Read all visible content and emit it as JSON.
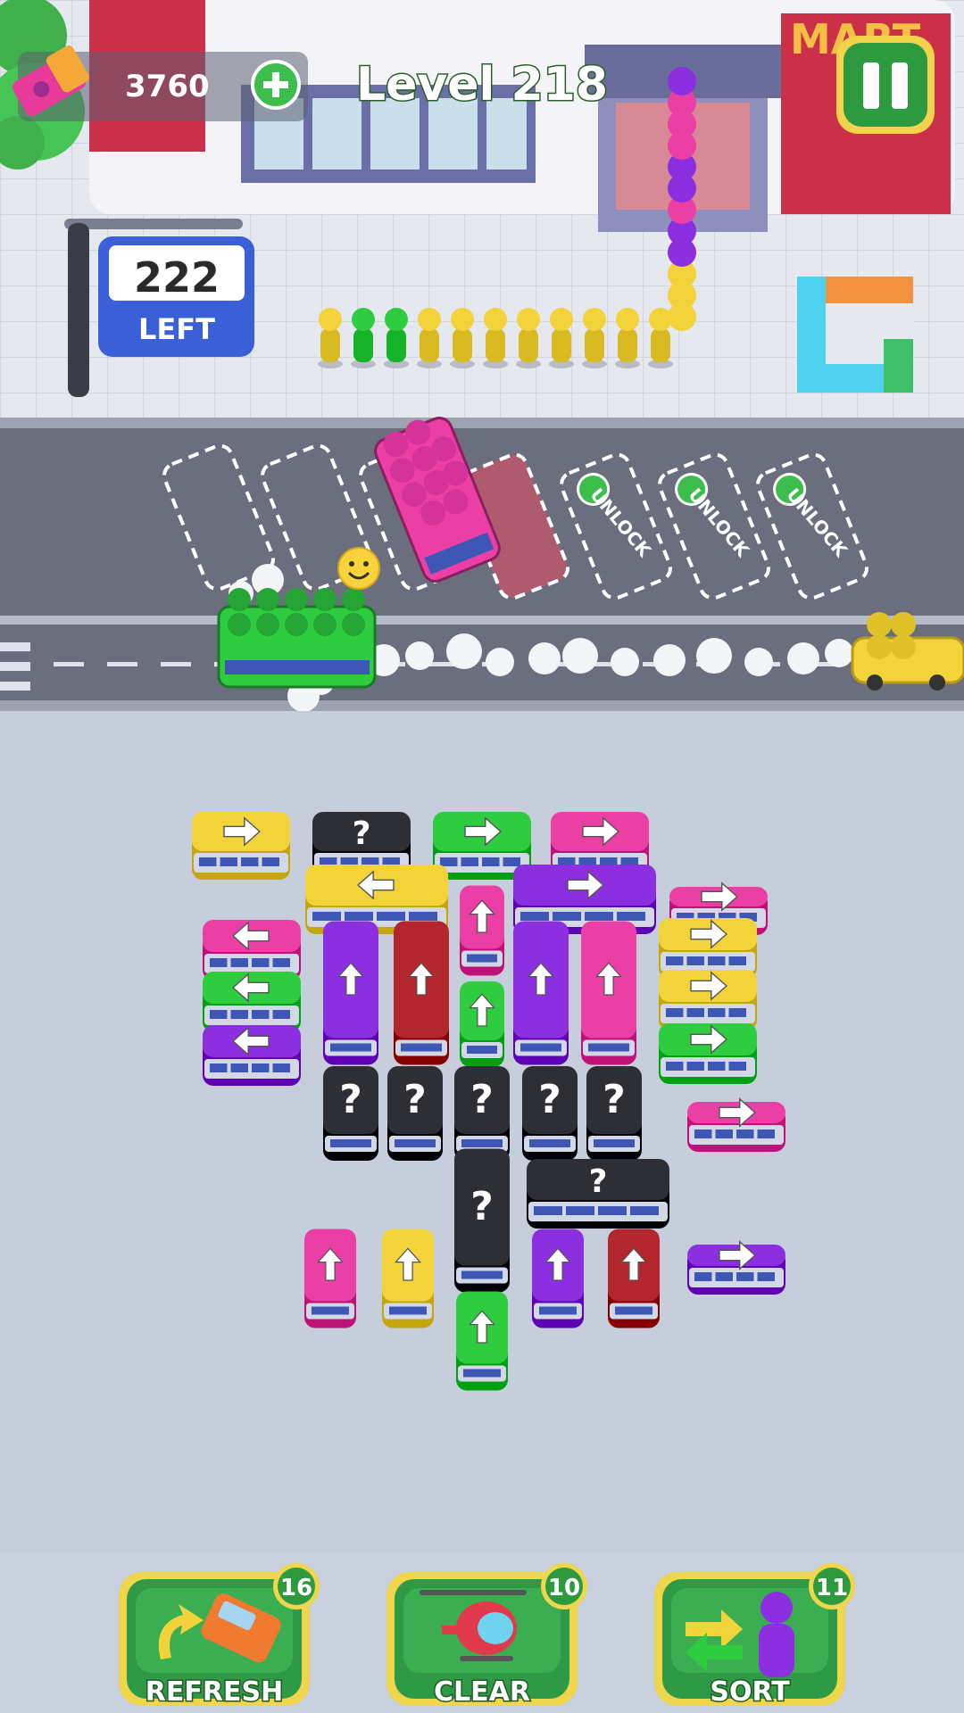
{
  "hud": {
    "currency_amount": "3760",
    "level_label": "Level 218",
    "left_count": "222",
    "left_label": "LEFT"
  },
  "store": {
    "sign_text": "MART"
  },
  "slots": {
    "unlock_label": "UNLOCK"
  },
  "boosters": [
    {
      "label": "REFRESH",
      "count": "16",
      "icon": "refresh-car-icon"
    },
    {
      "label": "CLEAR",
      "count": "10",
      "icon": "helicopter-icon"
    },
    {
      "label": "SORT",
      "count": "11",
      "icon": "sort-person-icon"
    }
  ],
  "colors": {
    "yellow": "#f2d33a",
    "green": "#2ecc3f",
    "pink": "#ec3fa5",
    "purple": "#8c2fe0",
    "red": "#b3262e",
    "black": "#2e2f35",
    "road": "#686b7a",
    "lot": "#c6cddb",
    "button_green": "#2f9a45"
  },
  "lot_vehicles": [
    {
      "kind": "van",
      "color": "yellow",
      "dir": "right"
    },
    {
      "kind": "van",
      "color": "black",
      "dir": "mystery"
    },
    {
      "kind": "van",
      "color": "green",
      "dir": "right"
    },
    {
      "kind": "van",
      "color": "pink",
      "dir": "right"
    },
    {
      "kind": "bus",
      "color": "yellow",
      "dir": "left"
    },
    {
      "kind": "bus",
      "color": "purple",
      "dir": "right"
    },
    {
      "kind": "car",
      "color": "pink",
      "dir": "up"
    },
    {
      "kind": "car",
      "color": "pink",
      "dir": "right"
    },
    {
      "kind": "van",
      "color": "pink",
      "dir": "left"
    },
    {
      "kind": "van",
      "color": "green",
      "dir": "left"
    },
    {
      "kind": "van",
      "color": "purple",
      "dir": "left"
    },
    {
      "kind": "bus",
      "color": "purple",
      "dir": "up"
    },
    {
      "kind": "bus",
      "color": "red",
      "dir": "up"
    },
    {
      "kind": "car",
      "color": "green",
      "dir": "up"
    },
    {
      "kind": "bus",
      "color": "purple",
      "dir": "up"
    },
    {
      "kind": "bus",
      "color": "pink",
      "dir": "up"
    },
    {
      "kind": "van",
      "color": "yellow",
      "dir": "right"
    },
    {
      "kind": "van",
      "color": "yellow",
      "dir": "right"
    },
    {
      "kind": "van",
      "color": "green",
      "dir": "right"
    },
    {
      "kind": "van",
      "color": "black",
      "dir": "mystery"
    },
    {
      "kind": "van",
      "color": "black",
      "dir": "mystery"
    },
    {
      "kind": "van",
      "color": "black",
      "dir": "mystery"
    },
    {
      "kind": "van",
      "color": "black",
      "dir": "mystery"
    },
    {
      "kind": "van",
      "color": "black",
      "dir": "mystery"
    },
    {
      "kind": "car",
      "color": "pink",
      "dir": "right"
    },
    {
      "kind": "bus",
      "color": "black",
      "dir": "mystery"
    },
    {
      "kind": "bus",
      "color": "black",
      "dir": "mystery"
    },
    {
      "kind": "van",
      "color": "pink",
      "dir": "up"
    },
    {
      "kind": "van",
      "color": "yellow",
      "dir": "up"
    },
    {
      "kind": "van",
      "color": "purple",
      "dir": "up"
    },
    {
      "kind": "van",
      "color": "red",
      "dir": "up"
    },
    {
      "kind": "car",
      "color": "purple",
      "dir": "right"
    },
    {
      "kind": "van",
      "color": "green",
      "dir": "up"
    }
  ]
}
